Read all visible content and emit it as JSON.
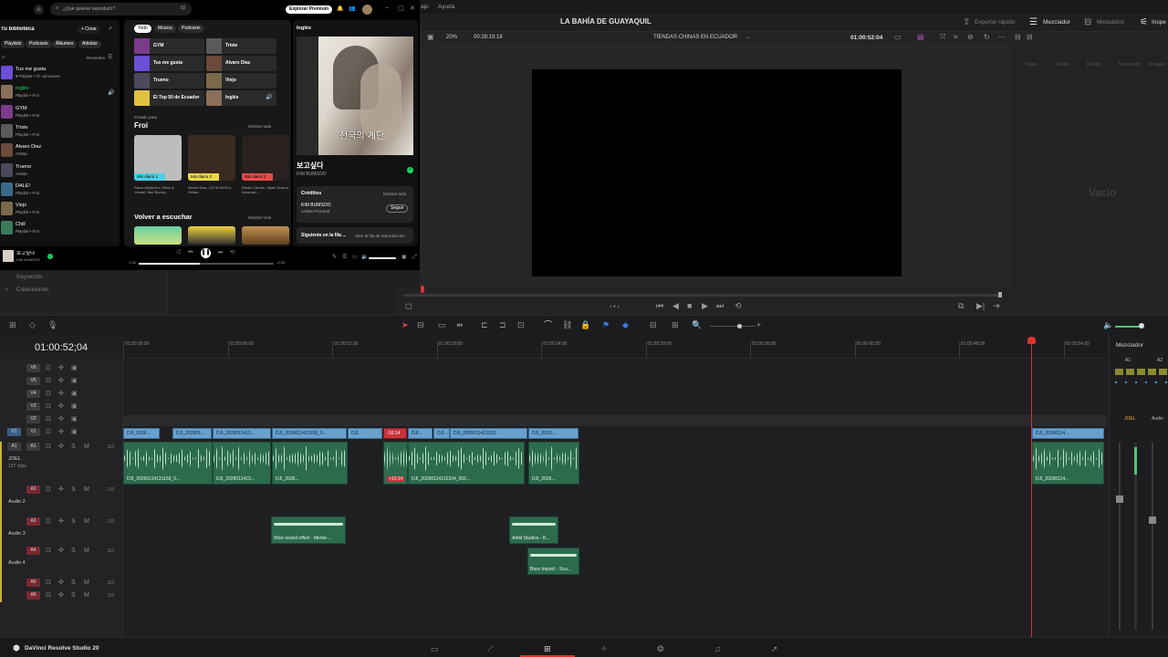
{
  "spotify": {
    "search_placeholder": "¿Qué quieres reproducir?",
    "premium_btn": "Explorar Premium",
    "library_title": "Tu biblioteca",
    "create_btn": "+ Crear",
    "lib_filters": [
      "Playlists",
      "Podcasts",
      "Álbumes",
      "Artistas"
    ],
    "recent": "Recientes",
    "library": [
      {
        "name": "Tus me gusta",
        "sub": "♥ Playlist • 37 canciones",
        "color": "#6b4fd8"
      },
      {
        "name": "Inglés",
        "sub": "Playlist • Froi",
        "color": "#8a6f5a"
      },
      {
        "name": "GYM",
        "sub": "Playlist • Froi",
        "color": "#7a3c8a"
      },
      {
        "name": "Triste",
        "sub": "Playlist • Froi",
        "color": "#5a5a5a"
      },
      {
        "name": "Alvaro Diaz",
        "sub": "Artista",
        "color": "#6a4a3a"
      },
      {
        "name": "Trueno",
        "sub": "Artista",
        "color": "#4a4a5a"
      },
      {
        "name": "DALE!",
        "sub": "Playlist • Froi",
        "color": "#3a6a8a"
      },
      {
        "name": "Viejo",
        "sub": "Playlist • Froi",
        "color": "#7a6a4a"
      },
      {
        "name": "Chill",
        "sub": "Playlist • Froi",
        "color": "#3a7a5a"
      }
    ],
    "tabs": [
      "Todo",
      "Música",
      "Podcasts"
    ],
    "quick": [
      {
        "name": "GYM",
        "color": "#7a3c8a"
      },
      {
        "name": "Triste",
        "color": "#5a5a5a"
      },
      {
        "name": "Tus me gusta",
        "color": "#6b4fd8"
      },
      {
        "name": "Alvaro Diaz",
        "color": "#6a4a3a"
      },
      {
        "name": "Trueno",
        "color": "#4a4a5a"
      },
      {
        "name": "Viejo",
        "color": "#7a6a4a"
      },
      {
        "name": "El Top 50 de Ecuador",
        "color": "#e0c040"
      },
      {
        "name": "Inglés",
        "color": "#8a6f5a"
      }
    ],
    "created_for": "Creado para",
    "section1": "Froi",
    "show_all": "Mostrar todo",
    "mixes": [
      {
        "label": "Mix diario 1",
        "color": "#49d0e8",
        "img": "#bdbdbd",
        "sub": "Rauw Alejandro, Wisin & Yandel, Bad Bunny..."
      },
      {
        "label": "Mix diario 2",
        "color": "#e8d84a",
        "img": "#3a2a22",
        "sub": "Alvaro Diaz, LATIN MAFIA, Sebas..."
      },
      {
        "label": "Mix diario 3",
        "color": "#e84a4a",
        "img": "#2a2020",
        "sub": "Eladio Carrion, Myke Towers, Arcangel..."
      }
    ],
    "section2": "Volver a escuchar",
    "show_all2": "Mostrar todo",
    "np_header": "Inglés",
    "np_title": "보고싶다",
    "np_artist": "KIM BUMSOO",
    "album_text": "천국의 계단",
    "credits": "Créditos",
    "credits_show": "Mostrar todo",
    "credit_name": "KIM BUMSOO",
    "credit_role": "Artista Principal",
    "follow": "Seguir",
    "queue_label": "Siguiente en la fila ...",
    "queue_open": "Abrir la fila de reproducción",
    "player_title": "보고싶다",
    "player_artist": "KIM BUMSOO",
    "time_cur": "1:33",
    "time_total": "-2:25",
    "progress": 0.45
  },
  "resolve": {
    "menu": [
      "ajo",
      "Ayuda"
    ],
    "project_title": "LA BAHÍA DE GUAYAQUIL",
    "export": "Exportar rápido",
    "mixer": "Mezclador",
    "metadata": "Metadatos",
    "inspector": "Inspe",
    "zoom": "20%",
    "duration": "00:28:19:18",
    "timeline_name": "TIENDAS CHINAS EN ECUADOR",
    "viewer_tc": "01:00:52:04",
    "empty": "Vacío",
    "insp_tabs": [
      "Video",
      "Audio",
      "Efecto",
      "Transición",
      "Imagen"
    ],
    "keywords": "Keywords",
    "collections": "Colecciones",
    "timecode": "01:00:52;04",
    "ruler": [
      "01:00:00;00",
      "01:00:06;00",
      "01:00:12;00",
      "01:00:18;00",
      "01:00:24;00",
      "01:00:30;00",
      "01:00:36;00",
      "01:00:42;00",
      "01:00:48;00",
      "01:00:54;00"
    ],
    "video_tracks": [
      "V6",
      "V5",
      "V4",
      "V3",
      "V2",
      "V1"
    ],
    "audio_tracks": [
      {
        "id": "A1",
        "name": "JOEL",
        "sub": "137 clips",
        "vol": "2.0"
      },
      {
        "id": "A2",
        "name": "Audio 2",
        "vol": "2.0"
      },
      {
        "id": "A3",
        "name": "Audio 3",
        "vol": "2.0"
      },
      {
        "id": "A4",
        "name": "Audio 4",
        "vol": "2.0"
      },
      {
        "id": "A5",
        "vol": "2.0"
      },
      {
        "id": "A6",
        "vol": "2.0"
      }
    ],
    "v1_clips": [
      "DJI_2026...",
      "DJI_202601...",
      "DJI_2026011413...",
      "DJI_2026011413036_0...",
      "DJI...",
      "-10:14",
      "DJI...",
      "DJI...",
      "DJI_2026011413233...",
      "DJI_2026...",
      "DJI_20260114..."
    ],
    "a1_clips": [
      "DJI_20260114131158_0...",
      "DJI_2026011413...",
      "DJI_2026...",
      "+10:14",
      "DJI_20260114132334_052...",
      "DJI_2026...",
      "DJI_20260114..."
    ],
    "sfx": [
      {
        "name": "Wow sound effect - Meme ..."
      },
      {
        "name": "Artist Studios - B..."
      },
      {
        "name": "Bass Impact - Sou..."
      }
    ],
    "mixer_title": "Mezclador",
    "mixer_ch": [
      "A1",
      "A2"
    ],
    "mixer_name": "JOEL",
    "mixer_name2": "Audio",
    "app_name": "DaVinci Resolve Studio 20"
  }
}
